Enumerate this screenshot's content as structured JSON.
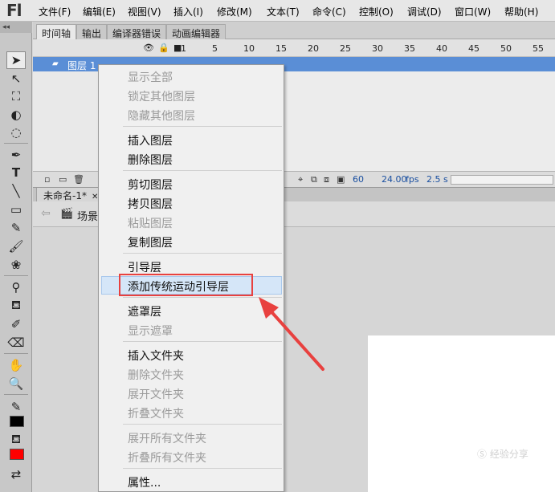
{
  "app": {
    "logo": "Fl"
  },
  "menubar": {
    "items": [
      "文件(F)",
      "编辑(E)",
      "视图(V)",
      "插入(I)",
      "修改(M)",
      "文本(T)",
      "命令(C)",
      "控制(O)",
      "调试(D)",
      "窗口(W)",
      "帮助(H)"
    ]
  },
  "toolbar": {
    "collapse": "◂◂",
    "stroke_color": "#000000",
    "fill_color": "#ff0000"
  },
  "panel_tabs": [
    "时间轴",
    "输出",
    "编译器错误",
    "动画编辑器"
  ],
  "timeline": {
    "header_icons": [
      "eye-icon",
      "lock-icon",
      "outline-icon"
    ],
    "frame_numbers": [
      "1",
      "5",
      "10",
      "15",
      "20",
      "25",
      "30",
      "35",
      "40",
      "45",
      "50",
      "55"
    ],
    "layer": {
      "name": "图层 1",
      "pencil": "✎"
    },
    "footer": {
      "frame": "60",
      "fps": "24.00",
      "fps_unit": "fps",
      "time": "2.5 s"
    }
  },
  "document": {
    "tab": "未命名-1*",
    "close": "✕",
    "scene": "场景 1"
  },
  "context_menu": {
    "items": [
      {
        "label": "显示全部",
        "disabled": true
      },
      {
        "label": "锁定其他图层",
        "disabled": true
      },
      {
        "label": "隐藏其他图层",
        "disabled": true
      },
      {
        "label": "插入图层",
        "disabled": false
      },
      {
        "label": "删除图层",
        "disabled": false
      },
      {
        "label": "剪切图层",
        "disabled": false
      },
      {
        "label": "拷贝图层",
        "disabled": false
      },
      {
        "label": "粘贴图层",
        "disabled": true
      },
      {
        "label": "复制图层",
        "disabled": false
      },
      {
        "label": "引导层",
        "disabled": false
      },
      {
        "label": "添加传统运动引导层",
        "disabled": false,
        "highlighted": true
      },
      {
        "label": "遮罩层",
        "disabled": false
      },
      {
        "label": "显示遮罩",
        "disabled": true
      },
      {
        "label": "插入文件夹",
        "disabled": false
      },
      {
        "label": "删除文件夹",
        "disabled": true
      },
      {
        "label": "展开文件夹",
        "disabled": true
      },
      {
        "label": "折叠文件夹",
        "disabled": true
      },
      {
        "label": "展开所有文件夹",
        "disabled": true
      },
      {
        "label": "折叠所有文件夹",
        "disabled": true
      },
      {
        "label": "属性...",
        "disabled": false
      }
    ]
  },
  "annotation": {
    "color": "#e8413f"
  },
  "watermark": {
    "text": "Ⓢ 经验分享",
    "sub": ""
  }
}
